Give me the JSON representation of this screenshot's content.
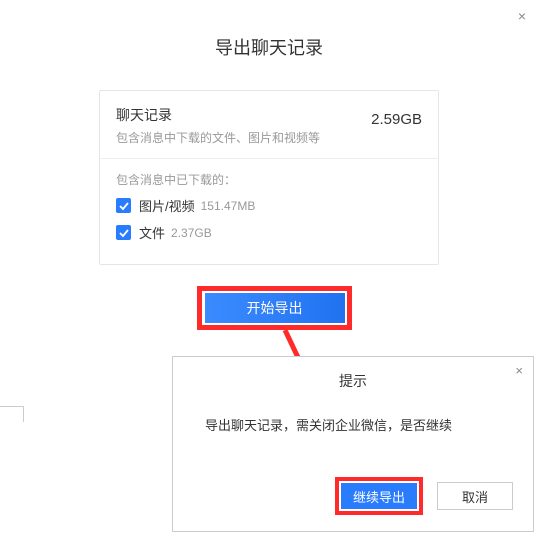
{
  "main": {
    "title": "导出聊天记录",
    "close_glyph": "×",
    "chat_label": "聊天记录",
    "chat_desc": "包含消息中下载的文件、图片和视频等",
    "total_size": "2.59GB",
    "downloaded_label": "包含消息中已下载的：",
    "items": [
      {
        "label": "图片/视频",
        "size": "151.47MB",
        "checked": true
      },
      {
        "label": "文件",
        "size": "2.37GB",
        "checked": true
      }
    ],
    "start_label": "开始导出"
  },
  "dialog": {
    "title": "提示",
    "close_glyph": "×",
    "body": "导出聊天记录，需关闭企业微信，是否继续",
    "continue_label": "继续导出",
    "cancel_label": "取消"
  },
  "annotation": {
    "highlight_color": "#ff2a2a",
    "arrow_color": "#ff2a2a"
  }
}
